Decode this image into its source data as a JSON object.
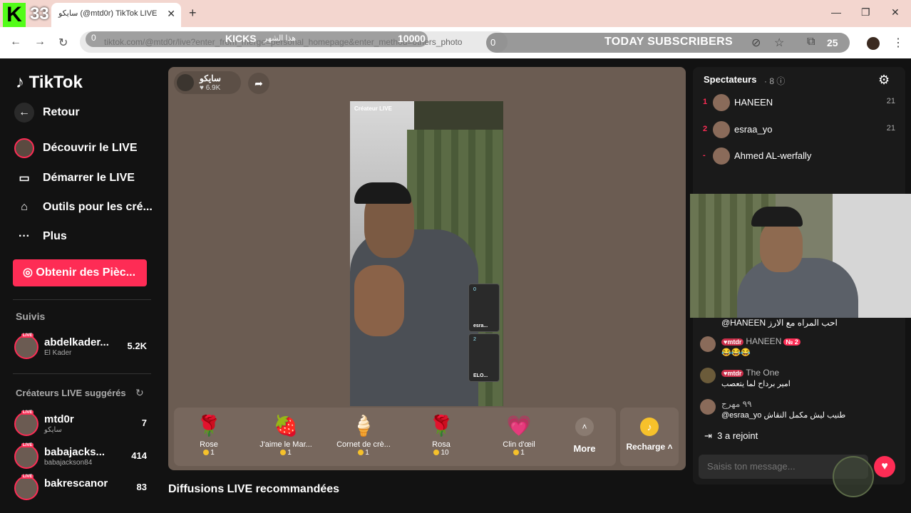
{
  "browser": {
    "kick_count": "33",
    "tab_title": "سايكو (@mtd0r) TikTok LIVE",
    "url": "tiktok.com/@mtd0r/live?enter_from_merge=personal_homepage&enter_method=others_photo",
    "overlay": {
      "left_zero": "0",
      "kicks_label": "KICKS",
      "monthly_label": "هذا الشهر",
      "goal": "10000",
      "subs_zero": "0",
      "subs_label": "TODAY SUBSCRIBERS",
      "subs_count": "25"
    }
  },
  "sidebar": {
    "logo": "TikTok",
    "back": "Retour",
    "items": [
      {
        "label": "Découvrir le LIVE",
        "icon": "live-avatar-icon"
      },
      {
        "label": "Démarrer le LIVE",
        "icon": "camera-icon"
      },
      {
        "label": "Outils pour les cré...",
        "icon": "home-tools-icon"
      },
      {
        "label": "Plus",
        "icon": "more-dots-icon"
      }
    ],
    "coins_button": "Obtenir des Pièc...",
    "following_label": "Suivis",
    "following": [
      {
        "name": "abdelkader...",
        "sub": "El Kader",
        "count": "5.2K"
      }
    ],
    "suggested_label": "Créateurs LIVE suggérés",
    "suggested": [
      {
        "name": "mtd0r",
        "sub": "سايكو",
        "count": "7"
      },
      {
        "name": "babajacks...",
        "sub": "babajackson84",
        "count": "414"
      },
      {
        "name": "bakrescanor",
        "sub": "",
        "count": "83"
      }
    ]
  },
  "stage": {
    "host_name": "سايكو",
    "host_likes": "6.9K",
    "video_tag": "Créateur LIVE",
    "guests": [
      {
        "num": "0",
        "label": "esra..."
      },
      {
        "num": "2",
        "label": "ELO..."
      }
    ],
    "gifts": [
      {
        "name": "Rose",
        "price": "1",
        "icon": "🌹"
      },
      {
        "name": "J'aime le Mar...",
        "price": "1",
        "icon": "🍓"
      },
      {
        "name": "Cornet de crè...",
        "price": "1",
        "icon": "🍦"
      },
      {
        "name": "Rosa",
        "price": "10",
        "icon": "🌹"
      },
      {
        "name": "Clin d'œil",
        "price": "1",
        "icon": "💗"
      }
    ],
    "more_label": "More",
    "recharge_label": "Recharge",
    "recommended_heading": "Diffusions LIVE recommandées"
  },
  "right_panel": {
    "spectators_title": "Spectateurs",
    "spectators_count": "8",
    "viewers": [
      {
        "rank": "1",
        "name": "HANEEN",
        "score": "21"
      },
      {
        "rank": "2",
        "name": "esraa_yo",
        "score": "21"
      },
      {
        "rank": "-",
        "name": "Ahmed AL-werfally",
        "score": ""
      }
    ],
    "chat": [
      {
        "user": "@HANEEN",
        "badge": "",
        "text": "احب المراه مع الارز",
        "line2": ""
      },
      {
        "user": "HANEEN",
        "badge": "mtdr",
        "level": "№ 2",
        "text": "",
        "line2": "😂😂😂"
      },
      {
        "user": "The One",
        "badge": "mtdr",
        "text": "",
        "line2": "امير برداح لما يتعصب"
      },
      {
        "user": "@esraa_yo",
        "badge": "",
        "text": "٩٩ مهرج",
        "line2": "طنيب ليش مكمل النقاش"
      }
    ],
    "joined_count": "3",
    "joined_text": "a rejoint",
    "input_placeholder": "Saisis ton message..."
  }
}
